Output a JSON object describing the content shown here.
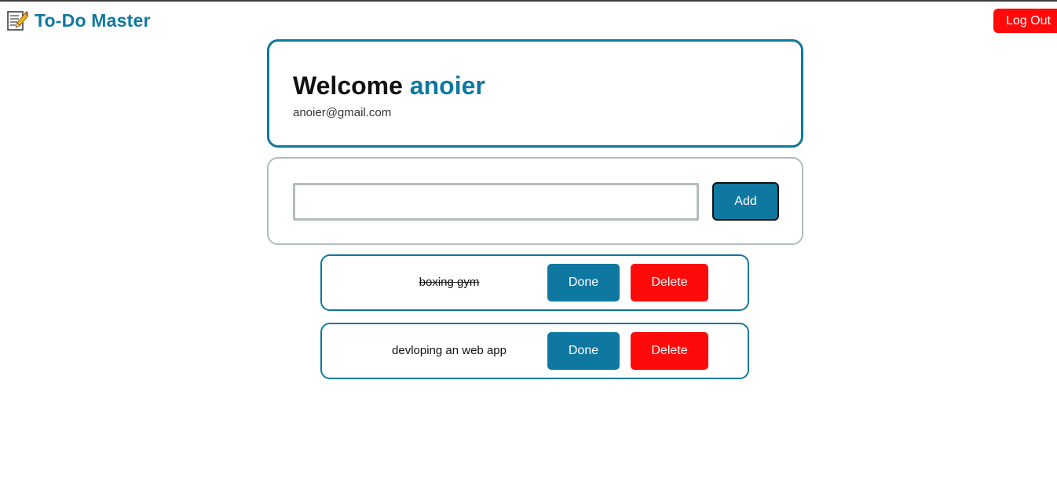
{
  "app": {
    "title": "To-Do Master",
    "icon": "memo-pencil-icon",
    "logout_label": "Log Out"
  },
  "welcome": {
    "greeting": "Welcome",
    "username": "anoier",
    "email": "anoier@gmail.com"
  },
  "add_form": {
    "input_value": "",
    "placeholder": "",
    "add_label": "Add"
  },
  "todos": [
    {
      "text": "boxing gym",
      "completed": true,
      "done_label": "Done",
      "delete_label": "Delete"
    },
    {
      "text": "devloping an web app",
      "completed": false,
      "done_label": "Done",
      "delete_label": "Delete"
    }
  ],
  "colors": {
    "accent": "#0f78a0",
    "danger": "#ff0a0a",
    "border_muted": "#b2bcbf"
  }
}
